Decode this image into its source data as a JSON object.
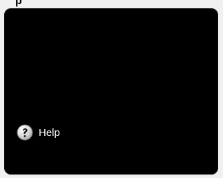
{
  "header": {
    "partial_title": "p"
  },
  "panel": {
    "help": {
      "label": "Help",
      "icon": "question-circle-icon"
    }
  }
}
